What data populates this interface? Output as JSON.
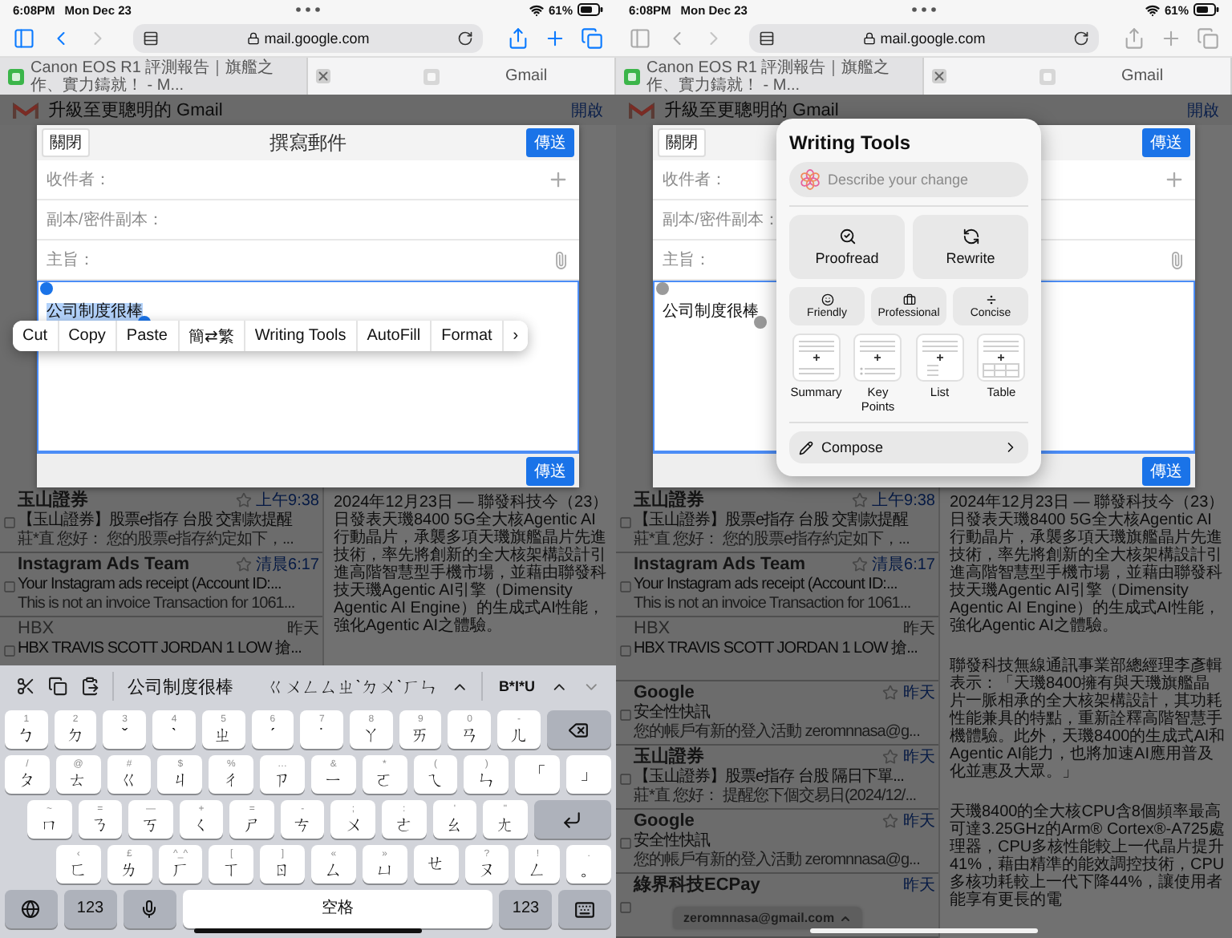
{
  "panes": [
    {
      "status_bar": {
        "time": "6:08PM",
        "date": "Mon Dec 23",
        "battery": "61%"
      },
      "toolbar": {
        "url": "mail.google.com",
        "active": true
      },
      "tabs": [
        {
          "title": "Canon EOS R1 評測報告｜旗艦之作、實力鑄就！ - M...",
          "selected": false
        },
        {
          "title": "Gmail",
          "selected": true
        }
      ],
      "banner": {
        "title": "升級至更聰明的 Gmail",
        "action": "開啟"
      },
      "emails": [
        {
          "sender": "玉山證券",
          "time": "上午9:38",
          "subject": "【玉山證券】股票e指存 台股 交割款提醒",
          "snippet": "莊*直 您好： 您的股票e指存約定如下，...",
          "unread": true
        },
        {
          "sender": "Instagram Ads Team",
          "time": "清晨6:17",
          "subject": "Your Instagram ads receipt (Account ID:...",
          "snippet": "This is not an invoice Transaction for 1061...",
          "unread": true
        },
        {
          "sender": "HBX",
          "time": "昨天",
          "subject": "HBX TRAVIS SCOTT JORDAN 1 LOW 搶...",
          "unread": false
        }
      ],
      "article": {
        "paragraphs": [
          "2024年12月23日 — 聯發科技今（23）日發表天璣8400 5G全大核Agentic AI行動晶片，承襲多項天璣旗艦晶片先進技術，率先將創新的全大核架構設計引進高階智慧型手機市場，並藉由聯發科技天璣Agentic AI引擎（Dimensity Agentic AI Engine）的生成式AI性能，強化Agentic AI之體驗。"
        ]
      },
      "compose": {
        "close": "關閉",
        "title": "撰寫郵件",
        "send": "傳送",
        "fields": [
          {
            "label": "收件者：",
            "kind": "add"
          },
          {
            "label": "副本/密件副本：",
            "kind": "plain"
          },
          {
            "label": "主旨：",
            "kind": "attach"
          }
        ],
        "body": {
          "text": "公司制度很棒",
          "highlighted": true
        },
        "footer_send": "傳送"
      },
      "overlay": {
        "kind": "edit_menu",
        "items": [
          "Cut",
          "Copy",
          "Paste",
          "簡⇄繁",
          "Writing Tools",
          "AutoFill",
          "Format"
        ],
        "more": "›"
      },
      "keyboard": {
        "candidate": "公司制度很棒",
        "reading": "ㄍㄨㄥㄙㄓˋㄉㄨˋㄏㄣ",
        "format": "B*I*U",
        "rows": [
          {
            "keys": [
              {
                "kind": "char",
                "hint": "1",
                "label": "ㄅ"
              },
              {
                "kind": "char",
                "hint": "2",
                "label": "ㄉ"
              },
              {
                "kind": "char",
                "hint": "3",
                "label": "ˇ"
              },
              {
                "kind": "char",
                "hint": "4",
                "label": "ˋ"
              },
              {
                "kind": "char",
                "hint": "5",
                "label": "ㄓ"
              },
              {
                "kind": "char",
                "hint": "6",
                "label": "ˊ"
              },
              {
                "kind": "char",
                "hint": "7",
                "label": "˙"
              },
              {
                "kind": "char",
                "hint": "8",
                "label": "ㄚ"
              },
              {
                "kind": "char",
                "hint": "9",
                "label": "ㄞ"
              },
              {
                "kind": "char",
                "hint": "0",
                "label": "ㄢ"
              },
              {
                "kind": "char",
                "hint": "-",
                "label": "ㄦ"
              },
              {
                "kind": "delete"
              }
            ]
          },
          {
            "keys": [
              {
                "kind": "char",
                "hint": "/",
                "label": "ㄆ"
              },
              {
                "kind": "char",
                "hint": "@",
                "label": "ㄊ"
              },
              {
                "kind": "char",
                "hint": "#",
                "label": "ㄍ"
              },
              {
                "kind": "char",
                "hint": "$",
                "label": "ㄐ"
              },
              {
                "kind": "char",
                "hint": "%",
                "label": "ㄔ"
              },
              {
                "kind": "char",
                "hint": "…",
                "label": "ㄗ"
              },
              {
                "kind": "char",
                "hint": "&",
                "label": "ㄧ"
              },
              {
                "kind": "char",
                "hint": "*",
                "label": "ㄛ"
              },
              {
                "kind": "char",
                "hint": "(",
                "label": "ㄟ"
              },
              {
                "kind": "char",
                "hint": ")",
                "label": "ㄣ"
              },
              {
                "kind": "char",
                "label": "「"
              },
              {
                "kind": "char",
                "label": "」"
              }
            ]
          },
          {
            "keys": [
              {
                "kind": "char",
                "hint": "~",
                "label": "ㄇ"
              },
              {
                "kind": "char",
                "hint": "=",
                "label": "ㄋ"
              },
              {
                "kind": "char",
                "hint": "—",
                "label": "ㄎ"
              },
              {
                "kind": "char",
                "hint": "+",
                "label": "ㄑ"
              },
              {
                "kind": "char",
                "hint": "=",
                "label": "ㄕ"
              },
              {
                "kind": "char",
                "hint": "-",
                "label": "ㄘ"
              },
              {
                "kind": "char",
                "hint": ";",
                "label": "ㄨ"
              },
              {
                "kind": "char",
                "hint": ":",
                "label": "ㄜ"
              },
              {
                "kind": "char",
                "hint": "'",
                "label": "ㄠ"
              },
              {
                "kind": "char",
                "hint": "\"",
                "label": "ㄤ"
              },
              {
                "kind": "return"
              }
            ]
          },
          {
            "keys": [
              {
                "kind": "char",
                "hint": "‹",
                "label": "ㄈ"
              },
              {
                "kind": "char",
                "hint": "£",
                "label": "ㄌ"
              },
              {
                "kind": "char",
                "hint": "^_^",
                "label": "ㄏ"
              },
              {
                "kind": "char",
                "hint": "[",
                "label": "ㄒ"
              },
              {
                "kind": "char",
                "hint": "]",
                "label": "ㄖ"
              },
              {
                "kind": "char",
                "hint": "«",
                "label": "ㄙ"
              },
              {
                "kind": "char",
                "hint": "»",
                "label": "ㄩ"
              },
              {
                "kind": "char",
                "label": "ㄝ"
              },
              {
                "kind": "char",
                "hint": "?",
                "label": "ㄡ"
              },
              {
                "kind": "char",
                "hint": "!",
                "label": "ㄥ"
              },
              {
                "kind": "char",
                "hint": ".",
                "label": "。"
              }
            ]
          },
          {
            "keys": [
              {
                "kind": "globe"
              },
              {
                "kind": "mode",
                "label": "123"
              },
              {
                "kind": "mic"
              },
              {
                "kind": "space",
                "label": "空格"
              },
              {
                "kind": "mode",
                "label": "123"
              },
              {
                "kind": "dismiss"
              }
            ]
          }
        ]
      }
    },
    {
      "status_bar": {
        "time": "6:08PM",
        "date": "Mon Dec 23",
        "battery": "61%"
      },
      "toolbar": {
        "url": "mail.google.com",
        "active": false
      },
      "tabs": [
        {
          "title": "Canon EOS R1 評測報告｜旗艦之作、實力鑄就！ - M...",
          "selected": false
        },
        {
          "title": "Gmail",
          "selected": true
        }
      ],
      "banner": {
        "title": "升級至更聰明的 Gmail",
        "action": "開啟"
      },
      "emails": [
        {
          "sender": "玉山證券",
          "time": "上午9:38",
          "subject": "【玉山證券】股票e指存 台股 交割款提醒",
          "snippet": "莊*直 您好： 您的股票e指存約定如下，...",
          "unread": true
        },
        {
          "sender": "Instagram Ads Team",
          "time": "清晨6:17",
          "subject": "Your Instagram ads receipt (Account ID:...",
          "snippet": "This is not an invoice Transaction for 1061...",
          "unread": true
        },
        {
          "sender": "HBX",
          "time": "昨天",
          "subject": "HBX TRAVIS SCOTT JORDAN 1 LOW 搶...",
          "unread": false
        },
        {
          "sender": "Google",
          "time": "昨天",
          "subject": "安全性快訊",
          "snippet": "您的帳戶有新的登入活動 zeromnnasa@g...",
          "unread": true
        },
        {
          "sender": "玉山證券",
          "time": "昨天",
          "subject": "【玉山證券】股票e指存 台股 隔日下單...",
          "snippet": "莊*直 您好： 提醒您下個交易日(2024/12/...",
          "unread": true
        },
        {
          "sender": "Google",
          "time": "昨天",
          "subject": "安全性快訊",
          "snippet": "您的帳戶有新的登入活動 zeromnnasa@g...",
          "unread": true
        },
        {
          "sender": "綠界科技ECPay",
          "time": "昨天",
          "unread": true
        }
      ],
      "article": {
        "paragraphs": [
          "2024年12月23日 — 聯發科技今（23）日發表天璣8400 5G全大核Agentic AI行動晶片，承襲多項天璣旗艦晶片先進技術，率先將創新的全大核架構設計引進高階智慧型手機市場，並藉由聯發科技天璣Agentic AI引擎（Dimensity Agentic AI Engine）的生成式AI性能，強化Agentic AI之體驗。",
          "聯發科技無線通訊事業部總經理李彥輯表示：「天璣8400擁有與天璣旗艦晶片一脈相承的全大核架構設計，其功耗性能兼具的特點，重新詮釋高階智慧手機體驗。此外，天璣8400的生成式AI和Agentic AI能力，也將加速AI應用普及化並惠及大眾。」",
          "天璣8400的全大核CPU含8個頻率最高可達3.25GHz的Arm® Cortex®-A725處理器，CPU多核性能較上一代晶片提升41%，藉由精準的能效調控技術，CPU多核功耗較上一代下降44%，讓使用者能享有更長的電"
        ]
      },
      "compose": {
        "close": "關閉",
        "send": "傳送",
        "fields": [
          {
            "label": "收件者：",
            "kind": "add"
          },
          {
            "label": "副本/密件副本：",
            "kind": "plain"
          },
          {
            "label": "主旨：",
            "kind": "attach"
          }
        ],
        "body": {
          "text": "公司制度很棒",
          "highlighted": false
        },
        "footer_send": "傳送"
      },
      "overlay": {
        "kind": "writing_tools",
        "title": "Writing Tools",
        "placeholder": "Describe your change",
        "actions": [
          {
            "label": "Proofread",
            "kind": "proofread"
          },
          {
            "label": "Rewrite",
            "kind": "rewrite"
          }
        ],
        "tones": [
          {
            "label": "Friendly",
            "kind": "friendly"
          },
          {
            "label": "Professional",
            "kind": "professional"
          },
          {
            "label": "Concise",
            "kind": "concise"
          }
        ],
        "formats": [
          {
            "label": "Summary",
            "kind": "summary"
          },
          {
            "label": "Key Points",
            "kind": "key_points"
          },
          {
            "label": "List",
            "kind": "list"
          },
          {
            "label": "Table",
            "kind": "table"
          }
        ],
        "compose": "Compose"
      },
      "account": "zeromnnasa@gmail.com"
    }
  ]
}
